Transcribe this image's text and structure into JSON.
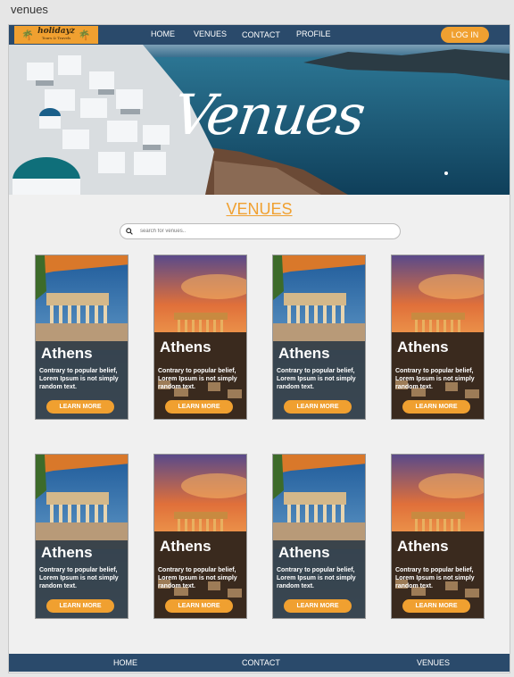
{
  "window": {
    "title": "venues"
  },
  "header": {
    "logo": {
      "name": "holidayz",
      "tagline": "Tours & Travels"
    },
    "nav": [
      "HOME",
      "VENUES",
      "CONTACT",
      "PROFILE"
    ],
    "login_label": "LOG IN"
  },
  "hero": {
    "title": "Venues"
  },
  "section": {
    "heading": "VENUES"
  },
  "search": {
    "placeholder": "search for venues.."
  },
  "cards": [
    {
      "city": "Athens",
      "desc": "Contrary to popular belief, Lorem Ipsum is not simply random text.",
      "button": "LEARN MORE"
    },
    {
      "city": "Athens",
      "desc": "Contrary to popular belief, Lorem Ipsum is not simply random text.",
      "button": "LEARN MORE"
    },
    {
      "city": "Athens",
      "desc": "Contrary to popular belief, Lorem Ipsum is not simply random text.",
      "button": "LEARN MORE"
    },
    {
      "city": "Athens",
      "desc": "Contrary to popular belief, Lorem Ipsum is not simply random text.",
      "button": "LEARN MORE"
    },
    {
      "city": "Athens",
      "desc": "Contrary to popular belief, Lorem Ipsum is not simply random text.",
      "button": "LEARN MORE"
    },
    {
      "city": "Athens",
      "desc": "Contrary to popular belief, Lorem Ipsum is not simply random text.",
      "button": "LEARN MORE"
    },
    {
      "city": "Athens",
      "desc": "Contrary to popular belief, Lorem Ipsum is not simply random text.",
      "button": "LEARN MORE"
    },
    {
      "city": "Athens",
      "desc": "Contrary to popular belief, Lorem Ipsum is not simply random text.",
      "button": "LEARN MORE"
    }
  ],
  "footer": {
    "links": [
      "HOME",
      "CONTACT",
      "VENUES"
    ]
  },
  "colors": {
    "navy": "#2a4a6b",
    "accent": "#f0a030",
    "background": "#f0f0f0"
  }
}
